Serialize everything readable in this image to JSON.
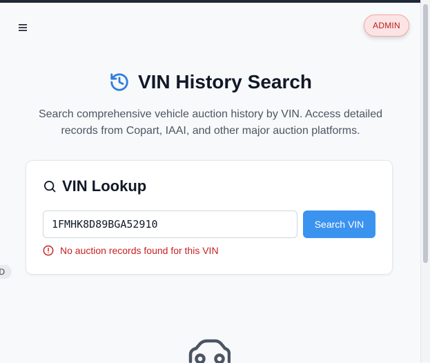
{
  "header": {
    "menu_icon": "hamburger-menu-icon",
    "admin_label": "ADMIN"
  },
  "hero": {
    "icon": "history-icon",
    "title": "VIN History Search",
    "description": "Search comprehensive vehicle auction history by VIN. Access detailed records from Copart, IAAI, and other major auction platforms."
  },
  "lookup": {
    "icon": "search-icon",
    "title": "VIN Lookup",
    "vin_value": "1FMHK8D89BGA52910",
    "button_label": "Search VIN",
    "error_icon": "alert-circle-icon",
    "error_message": "No auction records found for this VIN"
  },
  "side_chip": {
    "label": "D"
  },
  "empty_state": {
    "icon": "car-icon"
  },
  "colors": {
    "accent": "#3b93f0",
    "history_icon": "#2f7ee0",
    "error": "#c81e1e",
    "admin_bg": "#fde4e4",
    "admin_text": "#b91c1c"
  }
}
